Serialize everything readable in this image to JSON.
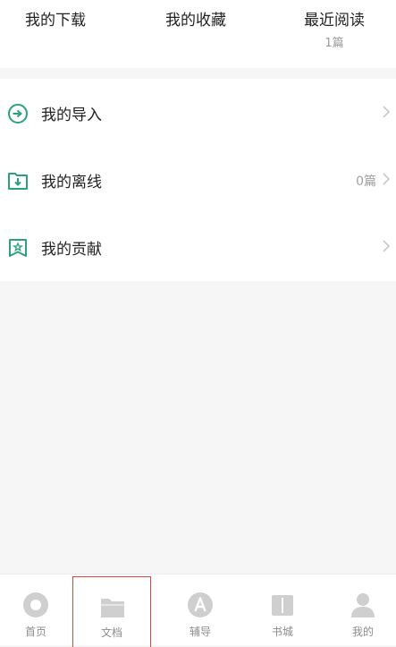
{
  "top_tabs": {
    "downloads": "我的下载",
    "favorites": "我的收藏",
    "recent": "最近阅读",
    "recent_count": "1篇"
  },
  "menu": {
    "import_label": "我的导入",
    "offline_label": "我的离线",
    "offline_count": "0篇",
    "contrib_label": "我的贡献"
  },
  "bottom_nav": {
    "home": "首页",
    "docs": "文档",
    "tutor": "辅导",
    "store": "书城",
    "me": "我的"
  },
  "colors": {
    "accent": "#2aa17f",
    "active_tab_border": "#d84545",
    "nav_icon": "#cfcfcf"
  }
}
